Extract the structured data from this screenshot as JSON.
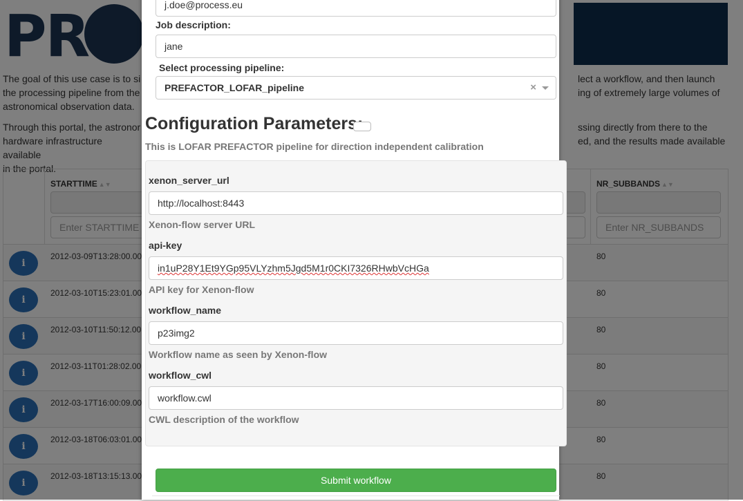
{
  "background": {
    "logo_text": "PROC",
    "intro_para1_left": [
      "The goal of this use case is to si",
      "the processing pipeline from the",
      "astronomical observation data."
    ],
    "intro_para1_right": [
      "lect a workflow, and then launch",
      "ing of extremely large volumes of"
    ],
    "intro_para2_left": [
      "Through this portal, the astronor",
      "hardware infrastructure available",
      "in the portal."
    ],
    "intro_para2_right": [
      "ssing directly from there to the",
      "ed, and the results made available"
    ],
    "table": {
      "col_starttime": "STARTTIME",
      "col_nr_subbands": "NR_SUBBANDS",
      "filter_starttime_placeholder": "Enter STARTTIME",
      "filter_nr_subbands_placeholder": "Enter NR_SUBBANDS",
      "info_icon": "i",
      "rows": [
        {
          "starttime": "2012-03-09T13:28:00.00",
          "nr_subbands": "80"
        },
        {
          "starttime": "2012-03-10T15:23:01.00",
          "nr_subbands": "80"
        },
        {
          "starttime": "2012-03-10T11:50:12.00",
          "nr_subbands": "80"
        },
        {
          "starttime": "2012-03-11T01:28:02.00",
          "nr_subbands": "80"
        },
        {
          "starttime": "2012-03-17T16:00:09.00",
          "nr_subbands": "80"
        },
        {
          "starttime": "2012-03-18T06:03:01.00",
          "nr_subbands": "80"
        },
        {
          "starttime": "2012-03-18T13:15:13.00",
          "nr_subbands": "80"
        }
      ]
    }
  },
  "modal": {
    "email_value": "j.doe@process.eu",
    "job_description_label": "Job description:",
    "job_description_value": "jane",
    "pipeline_label": "Select processing pipeline:",
    "pipeline_value": "PREFACTOR_LOFAR_pipeline",
    "pipeline_clear": "×",
    "config_title": "Configuration Parameters:",
    "config_description": "This is LOFAR PREFACTOR pipeline for direction independent calibration",
    "params": [
      {
        "name": "xenon_server_url",
        "value": "http://localhost:8443",
        "help": "Xenon-flow server URL"
      },
      {
        "name": "api-key",
        "value": "in1uP28Y1Et9YGp95VLYzhm5Jgd5M1r0CKI7326RHwbVcHGa",
        "help": "API key for Xenon-flow"
      },
      {
        "name": "workflow_name",
        "value": "p23img2",
        "help": "Workflow name as seen by Xenon-flow"
      },
      {
        "name": "workflow_cwl",
        "value": "workflow.cwl",
        "help": "CWL description of the workflow"
      }
    ],
    "submit_label": "Submit workflow"
  },
  "colors": {
    "overlay": "rgba(0,0,0,0.5)",
    "primary_blue": "#2a6fb6",
    "success_green": "#4cae4c",
    "banner_navy": "#0d2d4c"
  }
}
